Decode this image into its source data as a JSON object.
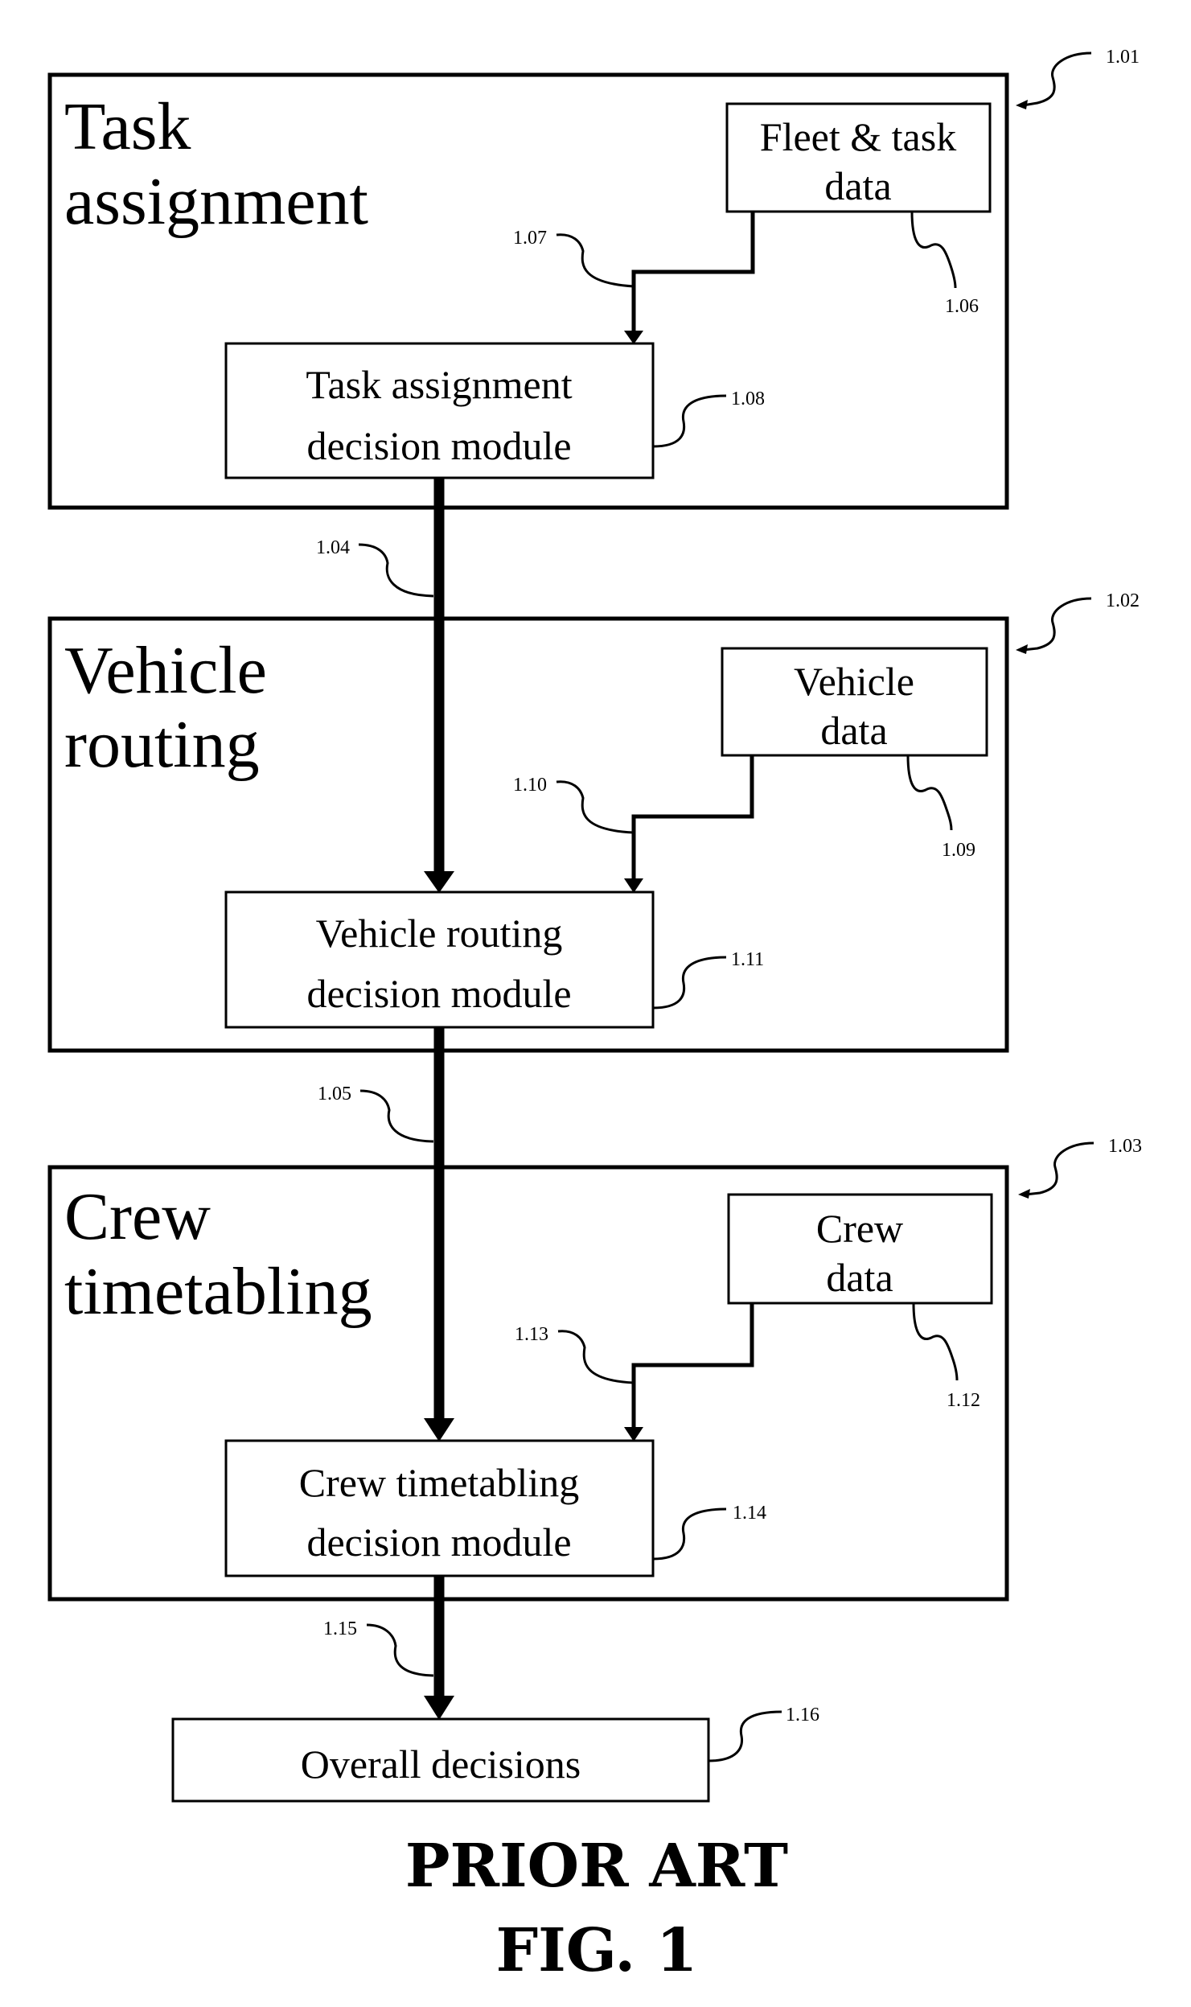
{
  "figure": {
    "caption_line1": "PRIOR ART",
    "caption_line2": "FIG. 1"
  },
  "stages": [
    {
      "ref": "1.01",
      "title_line1": "Task",
      "title_line2": "assignment",
      "data_box": {
        "line1": "Fleet & task",
        "line2": "data",
        "ref": "1.06"
      },
      "data_link_ref": "1.07",
      "module": {
        "line1": "Task assignment",
        "line2": "decision module",
        "ref": "1.08"
      }
    },
    {
      "ref": "1.02",
      "title_line1": "Vehicle",
      "title_line2": "routing",
      "data_box": {
        "line1": "Vehicle",
        "line2": "data",
        "ref": "1.09"
      },
      "data_link_ref": "1.10",
      "module": {
        "line1": "Vehicle routing",
        "line2": "decision module",
        "ref": "1.11"
      }
    },
    {
      "ref": "1.03",
      "title_line1": "Crew",
      "title_line2": "timetabling",
      "data_box": {
        "line1": "Crew",
        "line2": "data",
        "ref": "1.12"
      },
      "data_link_ref": "1.13",
      "module": {
        "line1": "Crew timetabling",
        "line2": "decision module",
        "ref": "1.14"
      }
    }
  ],
  "flows": [
    {
      "ref": "1.04"
    },
    {
      "ref": "1.05"
    },
    {
      "ref": "1.15"
    }
  ],
  "output": {
    "label": "Overall decisions",
    "ref": "1.16"
  }
}
